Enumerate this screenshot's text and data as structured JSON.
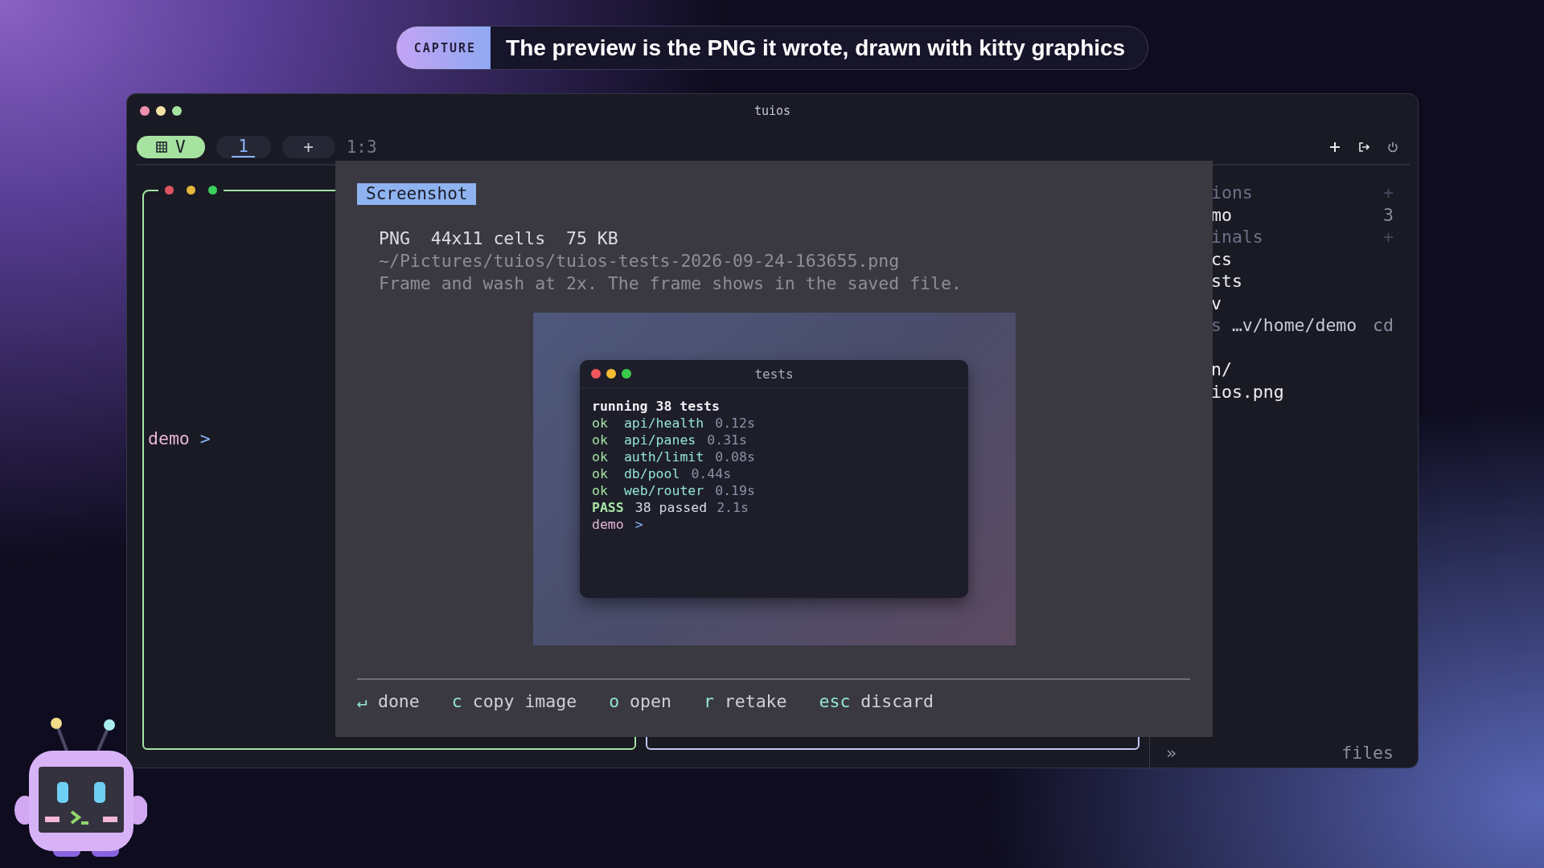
{
  "banner": {
    "badge": "CAPTURE",
    "caption": "The preview is the PNG it wrote, drawn with kitty graphics"
  },
  "window": {
    "title": "tuios"
  },
  "tabbar": {
    "workspace": {
      "label": "V"
    },
    "tabs": [
      {
        "label": "1",
        "selected": true
      }
    ],
    "new_tab": "+",
    "layout": "1:3"
  },
  "left_pane": {
    "prompt": {
      "user": "demo",
      "symbol": ">"
    }
  },
  "sidebar": {
    "entries": [
      {
        "kind": "header",
        "text": "ions",
        "trailing": "+"
      },
      {
        "kind": "item",
        "text": "mo",
        "trailing": "3"
      },
      {
        "kind": "header",
        "text": "inals",
        "trailing": "+"
      },
      {
        "kind": "item",
        "text": "cs"
      },
      {
        "kind": "item",
        "text": "sts"
      },
      {
        "kind": "item",
        "text": "v"
      },
      {
        "kind": "path",
        "prefix": "s",
        "text": "…v/home/demo",
        "trailing": "cd"
      }
    ],
    "files": [
      "n/",
      "ios.png"
    ],
    "footer": {
      "expand": "»",
      "label": "files"
    }
  },
  "modal": {
    "title": "Screenshot",
    "info": [
      {
        "text": "PNG  44x11 cells  75 KB",
        "dim": false
      },
      {
        "text": "~/Pictures/tuios/tuios-tests-2026-09-24-163655.png",
        "dim": true
      },
      {
        "text": "Frame and wash at 2x. The frame shows in the saved file.",
        "dim": true
      }
    ],
    "preview": {
      "title": "tests",
      "header": "running 38 tests",
      "results": [
        {
          "status": "ok",
          "name": "api/health",
          "time": "0.12s",
          "passed": true
        },
        {
          "status": "ok",
          "name": "api/panes",
          "time": "0.31s",
          "passed": true
        },
        {
          "status": "ok",
          "name": "auth/limit",
          "time": "0.08s",
          "passed": true
        },
        {
          "status": "ok",
          "name": "db/pool",
          "time": "0.44s",
          "passed": true
        },
        {
          "status": "ok",
          "name": "web/router",
          "time": "0.19s",
          "passed": true
        }
      ],
      "summary": {
        "status": "PASS",
        "text": "38 passed",
        "time": "2.1s",
        "passed": true
      },
      "prompt": {
        "user": "demo",
        "symbol": ">"
      }
    },
    "keys": [
      {
        "key": "↵",
        "action": "done"
      },
      {
        "key": "c",
        "action": "copy image"
      },
      {
        "key": "o",
        "action": "open"
      },
      {
        "key": "r",
        "action": "retake"
      },
      {
        "key": "esc",
        "action": "discard"
      }
    ]
  }
}
